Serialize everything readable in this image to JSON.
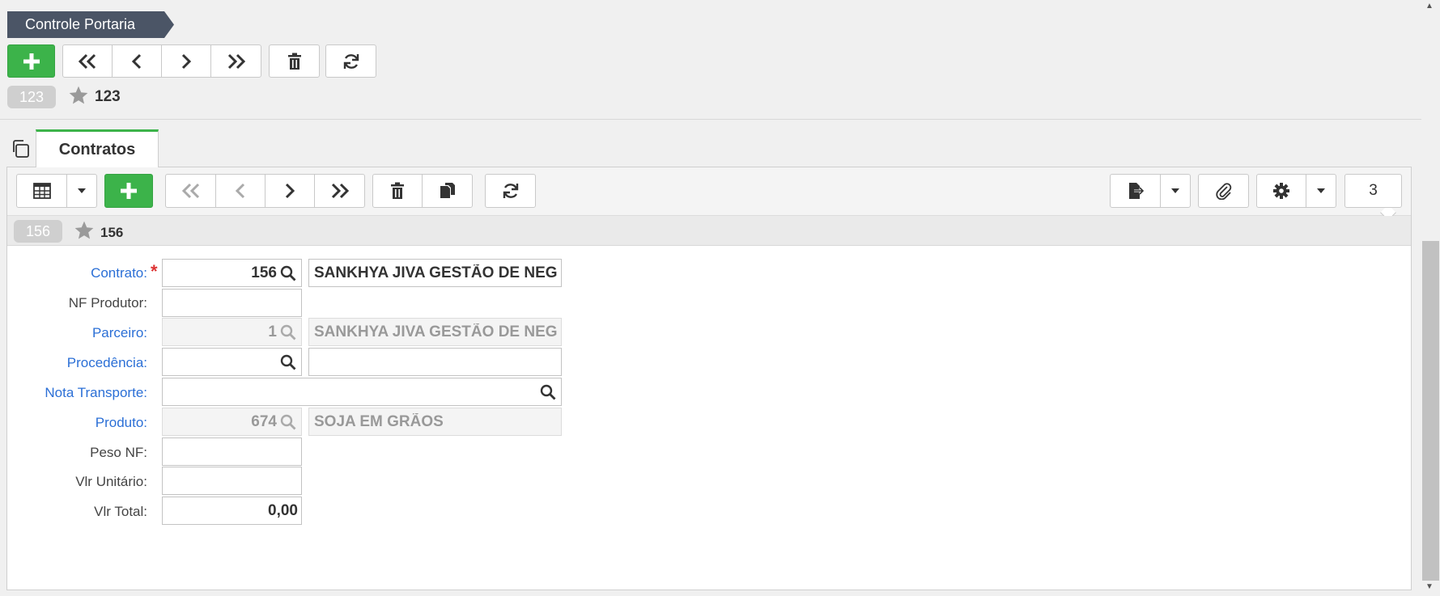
{
  "breadcrumb": {
    "title": "Controle Portaria"
  },
  "top_id": {
    "badge": "123",
    "value": "123"
  },
  "tab": {
    "label": "Contratos"
  },
  "detail_id": {
    "badge": "156",
    "value": "156"
  },
  "counter": {
    "value": "3"
  },
  "form": {
    "contrato": {
      "label": "Contrato:",
      "code": "156",
      "desc": "SANKHYA JIVA GESTÃO DE NEG"
    },
    "nf_produtor": {
      "label": "NF Produtor:",
      "value": ""
    },
    "parceiro": {
      "label": "Parceiro:",
      "code": "1",
      "desc": "SANKHYA JIVA GESTÃO DE NEG"
    },
    "procedencia": {
      "label": "Procedência:",
      "code": "",
      "desc": ""
    },
    "nota_transporte": {
      "label": "Nota Transporte:",
      "value": ""
    },
    "produto": {
      "label": "Produto:",
      "code": "674",
      "desc": "SOJA EM GRÃOS"
    },
    "peso_nf": {
      "label": "Peso NF:",
      "value": ""
    },
    "vlr_unitario": {
      "label": "Vlr Unitário:",
      "value": ""
    },
    "vlr_total": {
      "label": "Vlr Total:",
      "value": "0,00"
    }
  },
  "required_mark": "*",
  "colors": {
    "accent": "#3cb34a",
    "breadcrumb": "#4b5566",
    "link": "#2b6fd6"
  }
}
